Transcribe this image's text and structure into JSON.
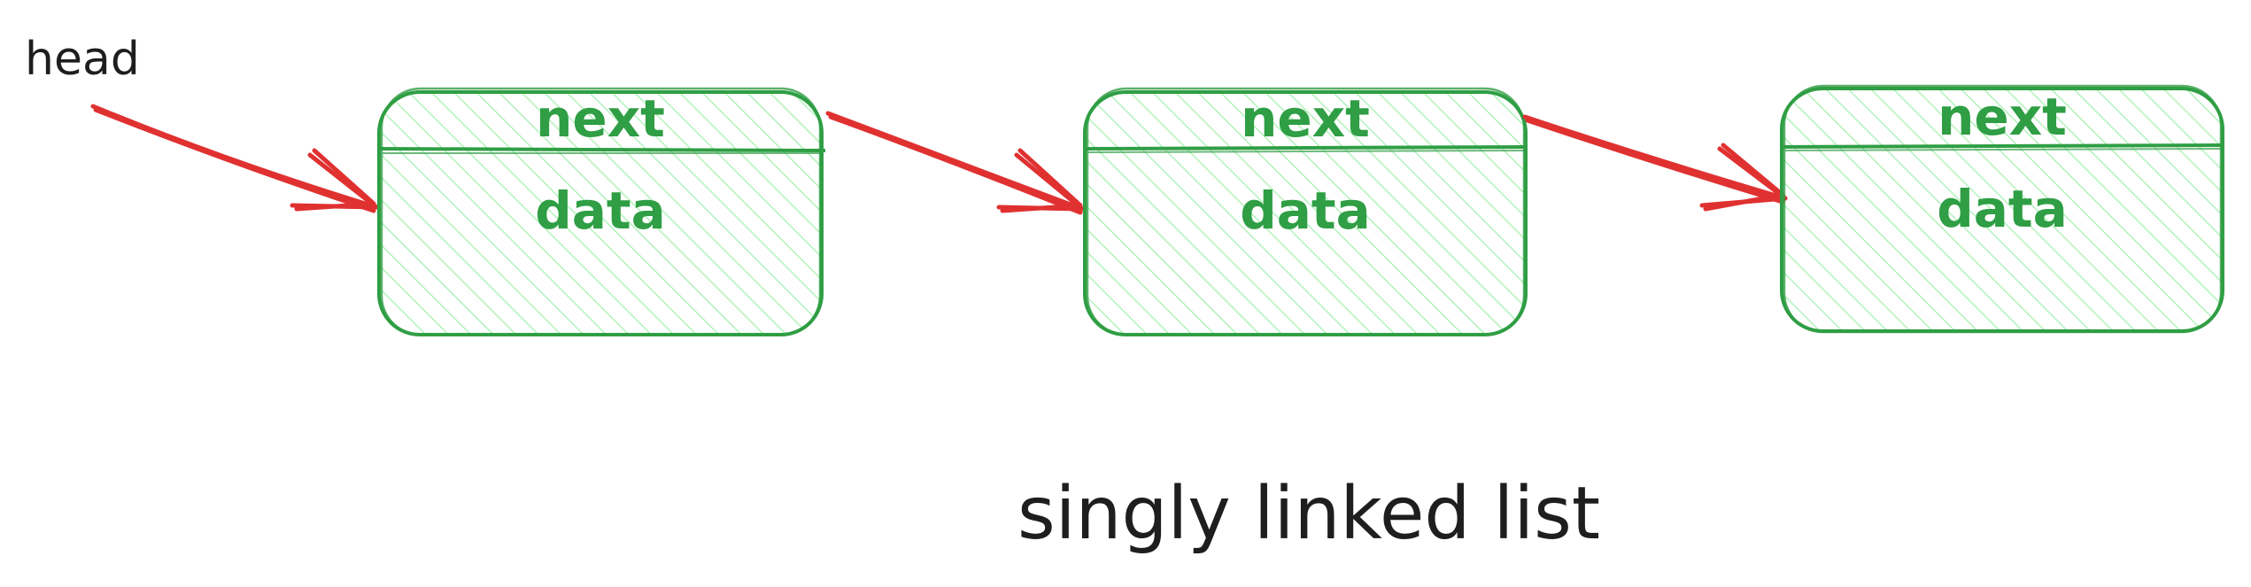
{
  "head_label": "head",
  "caption": "singly linked list",
  "colors": {
    "node_stroke": "#2f9e44",
    "node_fill": "#b2f2bb",
    "node_text": "#2f9e44",
    "arrow": "#e03131",
    "text": "#1e1e1e",
    "background": "#ffffff"
  },
  "nodes": [
    {
      "top_field": "next",
      "bottom_field": "data"
    },
    {
      "top_field": "next",
      "bottom_field": "data"
    },
    {
      "top_field": "next",
      "bottom_field": "data"
    }
  ]
}
